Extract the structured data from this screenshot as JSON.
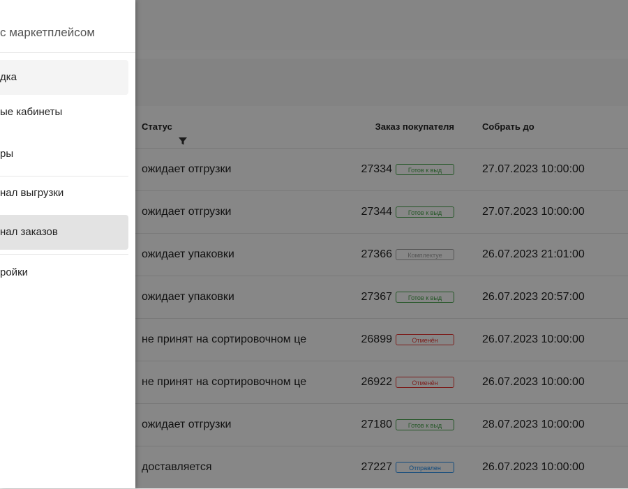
{
  "drawer": {
    "title": "с маркетплейсом",
    "items": [
      {
        "label": "дка",
        "state": "hover"
      },
      {
        "label": "ые кабинеты",
        "state": "normal"
      },
      {
        "label": "ры",
        "state": "normal"
      },
      {
        "label": "нал выгрузки",
        "state": "normal"
      },
      {
        "label": "нал заказов",
        "state": "active"
      },
      {
        "label": "ройки",
        "state": "normal"
      }
    ]
  },
  "table": {
    "headers": {
      "status": "Статус",
      "order": "Заказ покупателя",
      "collect_by": "Собрать до"
    },
    "rows": [
      {
        "status": "ожидает отгрузки",
        "order": "27334",
        "chip": "Готов к выд",
        "chip_type": "green",
        "date": "27.07.2023 10:00:00"
      },
      {
        "status": "ожидает отгрузки",
        "order": "27344",
        "chip": "Готов к выд",
        "chip_type": "green",
        "date": "27.07.2023 10:00:00"
      },
      {
        "status": "ожидает упаковки",
        "order": "27366",
        "chip": "Комплектуе",
        "chip_type": "grey",
        "date": "26.07.2023 21:01:00"
      },
      {
        "status": "ожидает упаковки",
        "order": "27367",
        "chip": "Готов к выд",
        "chip_type": "green",
        "date": "26.07.2023 20:57:00"
      },
      {
        "status": "не принят на сортировочном це",
        "order": "26899",
        "chip": "Отменён",
        "chip_type": "red",
        "date": "26.07.2023 10:00:00"
      },
      {
        "status": "не принят на сортировочном це",
        "order": "26922",
        "chip": "Отменён",
        "chip_type": "red",
        "date": "26.07.2023 10:00:00"
      },
      {
        "status": "ожидает отгрузки",
        "order": "27180",
        "chip": "Готов к выд",
        "chip_type": "green",
        "date": "28.07.2023 10:00:00"
      },
      {
        "status": "доставляется",
        "order": "27227",
        "chip": "Отправлен",
        "chip_type": "blue",
        "date": "26.07.2023 10:00:00"
      }
    ]
  },
  "colors": {
    "chip_green": "#43a047",
    "chip_red": "#e53935",
    "chip_blue": "#1e88e5",
    "chip_grey": "#9e9e9e",
    "menu_active_bg": "#e3e3e3",
    "menu_hover_bg": "#f4f4f4"
  },
  "icons": {
    "filter": "funnel-icon"
  }
}
